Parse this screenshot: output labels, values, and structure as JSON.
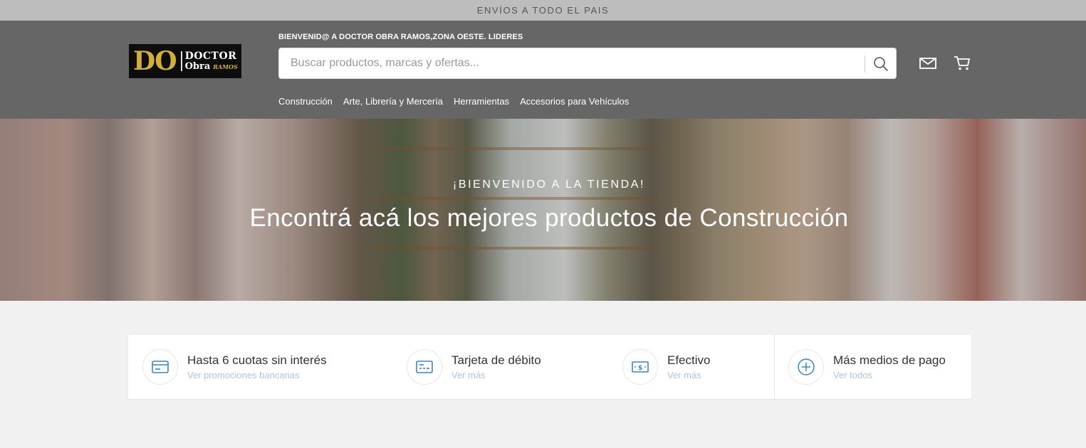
{
  "topbar": {
    "text": "ENVÍOS A TODO EL PAIS"
  },
  "header": {
    "logo": {
      "big": "DO",
      "line1": "DOCTOR",
      "line2": "Obra",
      "line3": "RAMOS"
    },
    "welcome": "BIENVENID@ A DOCTOR OBRA RAMOS,ZONA OESTE. LIDERES",
    "search": {
      "placeholder": "Buscar productos, marcas y ofertas..."
    },
    "nav": [
      "Construcción",
      "Arte, Librería y Mercería",
      "Herramientas",
      "Accesorios para Vehículos"
    ]
  },
  "hero": {
    "subtitle": "¡BIENVENIDO A LA TIENDA!",
    "headline": "Encontrá acá los mejores productos de Construcción"
  },
  "payments": [
    {
      "title": "Hasta 6 cuotas sin interés",
      "sub": "Ver promociones bancarias",
      "icon": "credit-card-icon"
    },
    {
      "title": "Tarjeta de débito",
      "sub": "Ver más",
      "icon": "debit-card-icon"
    },
    {
      "title": "Efectivo",
      "sub": "Ver más",
      "icon": "cash-icon"
    },
    {
      "title": "Más medios de pago",
      "sub": "Ver todos",
      "icon": "plus-circle-icon"
    }
  ],
  "colors": {
    "accent": "#3d82c4",
    "header_bg": "#666666",
    "topbar_bg": "#bdbdbd"
  }
}
